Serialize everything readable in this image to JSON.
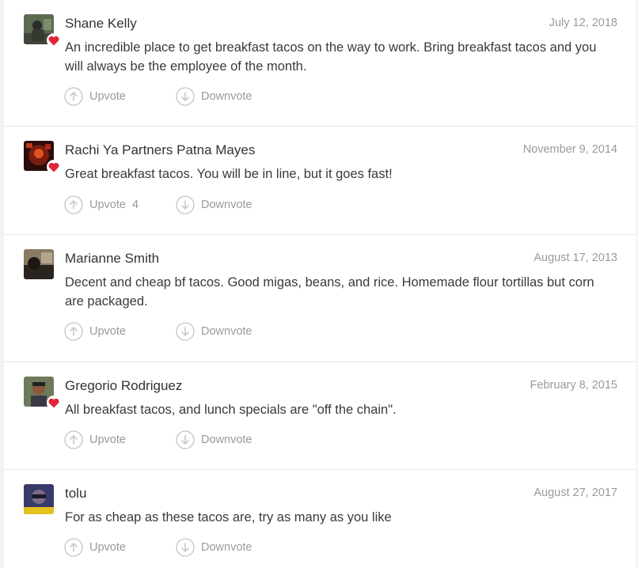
{
  "tips": [
    {
      "author": "Shane Kelly",
      "date": "July 12, 2018",
      "text": "An incredible place to get breakfast tacos on the way to work. Bring breakfast tacos and you will always be the employee of the month.",
      "upvote_label": "Upvote",
      "upvote_count": "",
      "downvote_label": "Downvote",
      "liked": true
    },
    {
      "author": "Rachi Ya Partners Patna Mayes",
      "date": "November 9, 2014",
      "text": "Great breakfast tacos. You will be in line, but it goes fast!",
      "upvote_label": "Upvote",
      "upvote_count": "4",
      "downvote_label": "Downvote",
      "liked": true
    },
    {
      "author": "Marianne Smith",
      "date": "August 17, 2013",
      "text": "Decent and cheap bf tacos. Good migas, beans, and rice. Homemade flour tortillas but corn are packaged.",
      "upvote_label": "Upvote",
      "upvote_count": "",
      "downvote_label": "Downvote",
      "liked": false
    },
    {
      "author": "Gregorio Rodriguez",
      "date": "February 8, 2015",
      "text": "All breakfast tacos, and lunch specials are \"off the chain\".",
      "upvote_label": "Upvote",
      "upvote_count": "",
      "downvote_label": "Downvote",
      "liked": true
    },
    {
      "author": "tolu",
      "date": "August 27, 2017",
      "text": "For as cheap as these tacos are, try as many as you like",
      "upvote_label": "Upvote",
      "upvote_count": "",
      "downvote_label": "Downvote",
      "liked": false
    }
  ],
  "colors": {
    "heart": "#e0263a",
    "muted": "#9a9a9a",
    "text": "#3a3a3a",
    "divider": "#e8e8ee"
  },
  "icons": {
    "upvote": "arrow-up-circle-icon",
    "downvote": "arrow-down-circle-icon",
    "liked": "heart-icon"
  }
}
